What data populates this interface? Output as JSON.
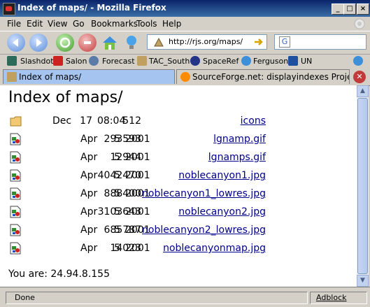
{
  "window": {
    "title": "Index of maps/ - Mozilla Firefox"
  },
  "menu": [
    {
      "label": "File"
    },
    {
      "label": "Edit"
    },
    {
      "label": "View"
    },
    {
      "label": "Go"
    },
    {
      "label": "Bookmarks"
    },
    {
      "label": "Tools"
    },
    {
      "label": "Help"
    }
  ],
  "navbar": {
    "url": "http://rjs.org/maps/",
    "search_icon": "G"
  },
  "bookmarks": [
    {
      "label": "Slashdot"
    },
    {
      "label": "Salon"
    },
    {
      "label": "Forecast"
    },
    {
      "label": "TAC_South"
    },
    {
      "label": "SpaceRef"
    },
    {
      "label": "Ferguson"
    },
    {
      "label": "UN"
    }
  ],
  "tabs": [
    {
      "label": "Index of maps/",
      "active": true
    },
    {
      "label": "SourceForge.net: displayindexes Project: Ad...",
      "active": false
    }
  ],
  "page": {
    "heading": "Index of maps/",
    "entries": [
      {
        "type": "folder",
        "size": "512",
        "month": "Dec",
        "day": "17",
        "time": "08:04",
        "name": "icons"
      },
      {
        "type": "image",
        "size": "293593",
        "month": "Apr",
        "day": "5",
        "time": "2001",
        "name": "lgnamp.gif"
      },
      {
        "type": "image",
        "size": "12944",
        "month": "Apr",
        "day": "5",
        "time": "2001",
        "name": "lgnamps.gif"
      },
      {
        "type": "image",
        "size": "4042470",
        "month": "Apr",
        "day": "5",
        "time": "2001",
        "name": "noblecanyon1.jpg"
      },
      {
        "type": "image",
        "size": "888400",
        "month": "Apr",
        "day": "5",
        "time": "2001",
        "name": "noblecanyon1_lowres.jpg"
      },
      {
        "type": "image",
        "size": "3103643",
        "month": "Apr",
        "day": "5",
        "time": "2001",
        "name": "noblecanyon2.jpg"
      },
      {
        "type": "image",
        "size": "685787",
        "month": "Apr",
        "day": "5",
        "time": "2001",
        "name": "noblecanyon2_lowres.jpg"
      },
      {
        "type": "image",
        "size": "14023",
        "month": "Apr",
        "day": "5",
        "time": "2001",
        "name": "noblecanyonmap.jpg"
      }
    ],
    "you_are": "You are: 24.94.8.155"
  },
  "status": {
    "text": "Done",
    "adblock": "Adblock"
  },
  "colors": {
    "titlebar": "#0a246a",
    "link": "#00008b",
    "tab_active": "#a6c4f0"
  }
}
